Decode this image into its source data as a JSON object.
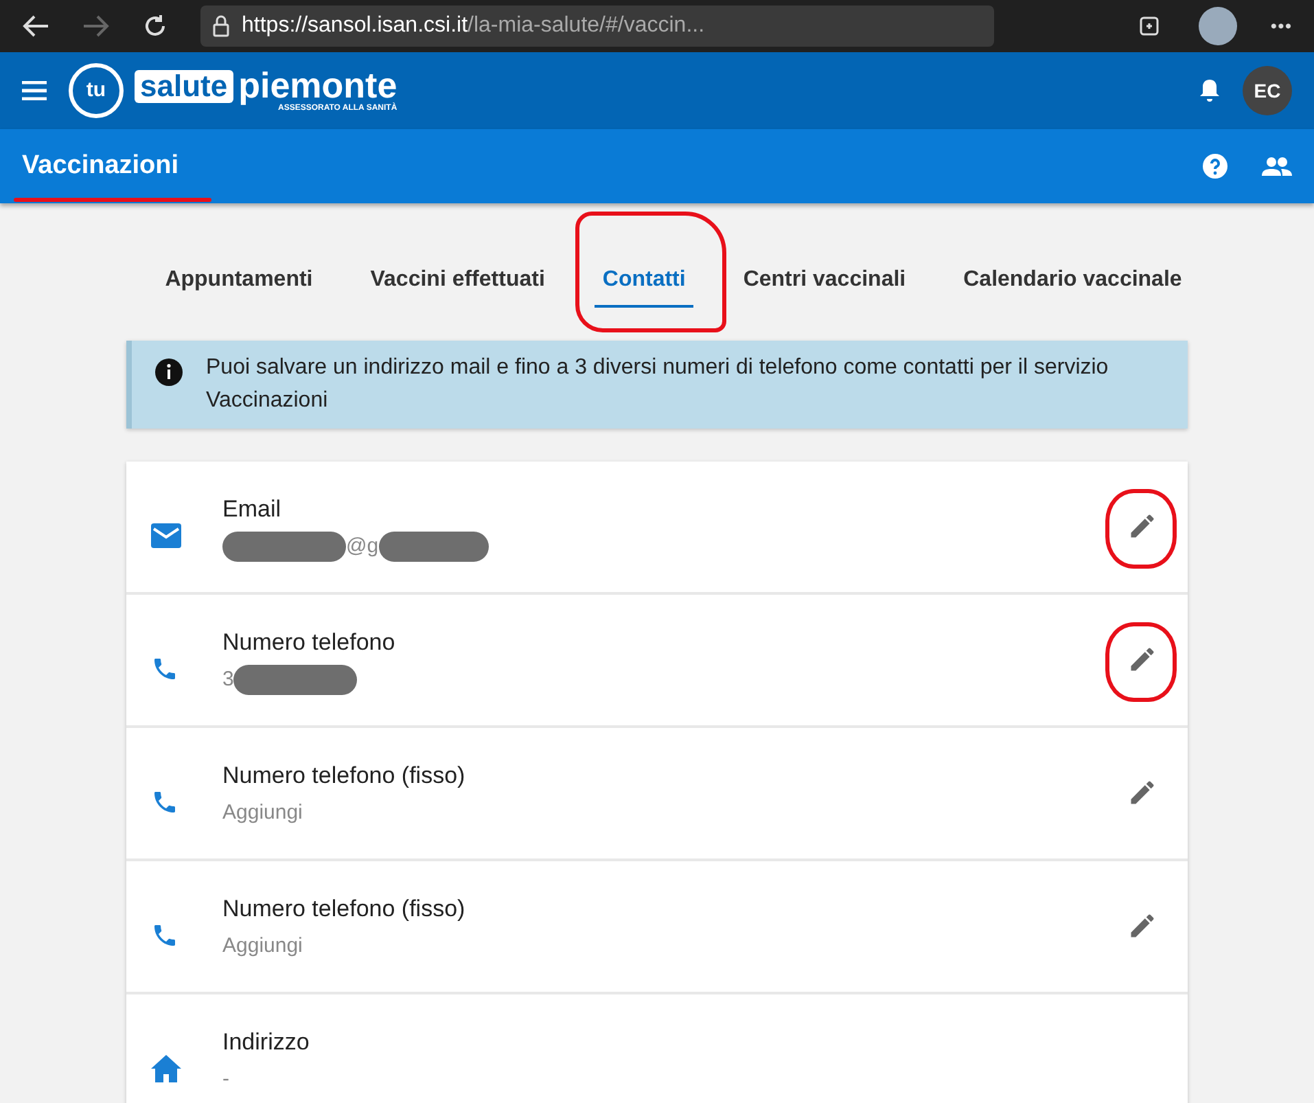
{
  "browser": {
    "url_host": "https://sansol.isan.csi.it",
    "url_path": "/la-mia-salute/#/vaccin..."
  },
  "header": {
    "logo_mark": "tu",
    "logo_word": "salute",
    "logo_region": "piemonte",
    "logo_sub": "ASSESSORATO ALLA SANITÀ",
    "avatar": "EC"
  },
  "subheader": {
    "title": "Vaccinazioni",
    "annotated": true
  },
  "tabs": [
    {
      "label": "Appuntamenti",
      "selected": false,
      "annotated": false
    },
    {
      "label": "Vaccini effettuati",
      "selected": false,
      "annotated": false
    },
    {
      "label": "Contatti",
      "selected": true,
      "annotated": true
    },
    {
      "label": "Centri vaccinali",
      "selected": false,
      "annotated": false
    },
    {
      "label": "Calendario vaccinale",
      "selected": false,
      "annotated": false
    }
  ],
  "info": "Puoi salvare un indirizzo mail e fino a 3 diversi numeri di telefono come contatti per il servizio Vaccinazioni",
  "contacts": [
    {
      "kind": "email",
      "label": "Email",
      "value": "@g",
      "redacted": true,
      "annotated": true,
      "editable": true
    },
    {
      "kind": "phone",
      "label": "Numero telefono",
      "value": "3",
      "redacted": true,
      "annotated": true,
      "editable": true
    },
    {
      "kind": "phone",
      "label": "Numero telefono (fisso)",
      "value": "Aggiungi",
      "redacted": false,
      "annotated": false,
      "editable": true
    },
    {
      "kind": "phone",
      "label": "Numero telefono (fisso)",
      "value": "Aggiungi",
      "redacted": false,
      "annotated": false,
      "editable": true
    },
    {
      "kind": "home",
      "label": "Indirizzo",
      "value": "-",
      "redacted": false,
      "annotated": false,
      "editable": false
    }
  ]
}
